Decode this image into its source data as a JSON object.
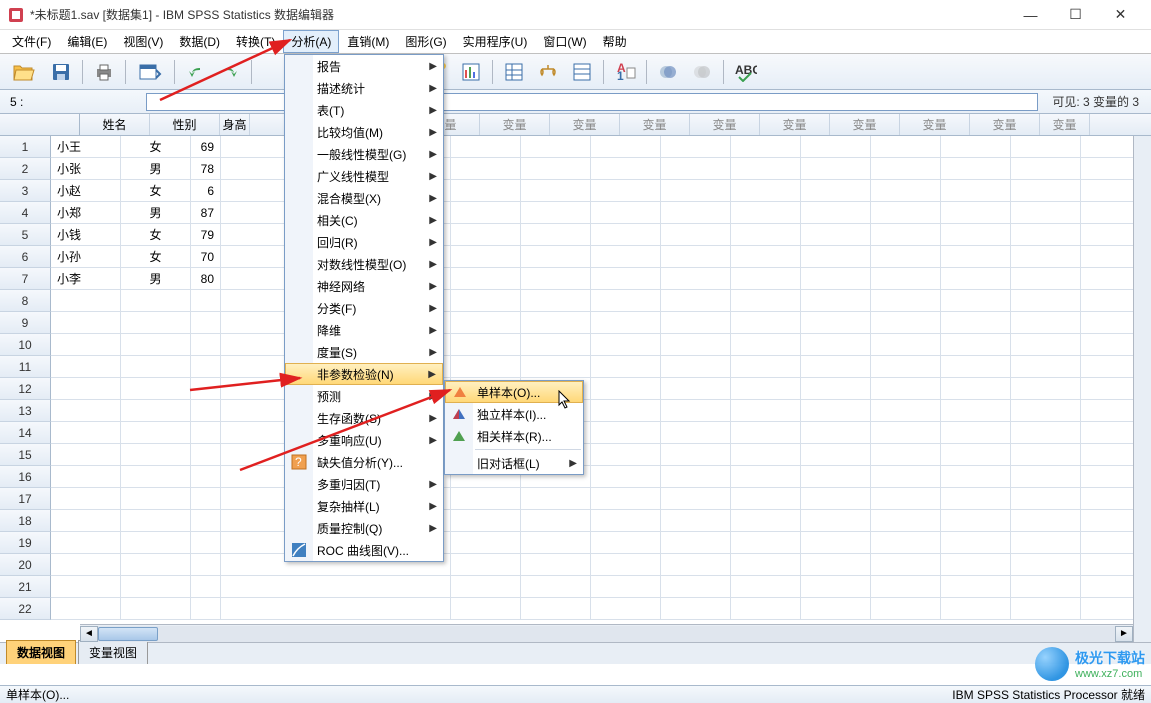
{
  "titlebar": {
    "title": "*未标题1.sav [数据集1] - IBM SPSS Statistics 数据编辑器"
  },
  "menubar": {
    "file": "文件(F)",
    "edit": "编辑(E)",
    "view": "视图(V)",
    "data": "数据(D)",
    "transform": "转换(T)",
    "analyze": "分析(A)",
    "direct": "直销(M)",
    "graphs": "图形(G)",
    "utilities": "实用程序(U)",
    "window": "窗口(W)",
    "help": "帮助"
  },
  "inputbar": {
    "address": "5 :",
    "value": "",
    "visible": "可见: 3 变量的 3"
  },
  "columns": {
    "named": [
      "姓名",
      "性别",
      "身高"
    ],
    "generic": "变量"
  },
  "rows": [
    {
      "c1": "小王",
      "c2": "女",
      "c3": "69"
    },
    {
      "c1": "小张",
      "c2": "男",
      "c3": "78"
    },
    {
      "c1": "小赵",
      "c2": "女",
      "c3": "6"
    },
    {
      "c1": "小郑",
      "c2": "男",
      "c3": "87"
    },
    {
      "c1": "小钱",
      "c2": "女",
      "c3": "79"
    },
    {
      "c1": "小孙",
      "c2": "女",
      "c3": "70"
    },
    {
      "c1": "小李",
      "c2": "男",
      "c3": "80"
    }
  ],
  "row_count": 22,
  "analyze_menu": {
    "reports": "报告",
    "descriptives": "描述统计",
    "tables": "表(T)",
    "compare_means": "比较均值(M)",
    "glm": "一般线性模型(G)",
    "gen_linear": "广义线性模型",
    "mixed": "混合模型(X)",
    "correlate": "相关(C)",
    "regression": "回归(R)",
    "loglinear": "对数线性模型(O)",
    "neural": "神经网络",
    "classify": "分类(F)",
    "dimred": "降维",
    "scale": "度量(S)",
    "nonparam": "非参数检验(N)",
    "forecast": "预测",
    "survival": "生存函数(S)",
    "multresp": "多重响应(U)",
    "missing": "缺失值分析(Y)...",
    "multimp": "多重归因(T)",
    "complex": "复杂抽样(L)",
    "quality": "质量控制(Q)",
    "roc": "ROC 曲线图(V)..."
  },
  "nonparam_submenu": {
    "one_sample": "单样本(O)...",
    "independent": "独立样本(I)...",
    "related": "相关样本(R)...",
    "legacy": "旧对话框(L)"
  },
  "viewtabs": {
    "data": "数据视图",
    "variable": "变量视图"
  },
  "statusbar": {
    "left": "单样本(O)...",
    "right": "IBM SPSS Statistics Processor 就绪"
  },
  "watermark": {
    "name": "极光下载站",
    "url": "www.xz7.com"
  }
}
